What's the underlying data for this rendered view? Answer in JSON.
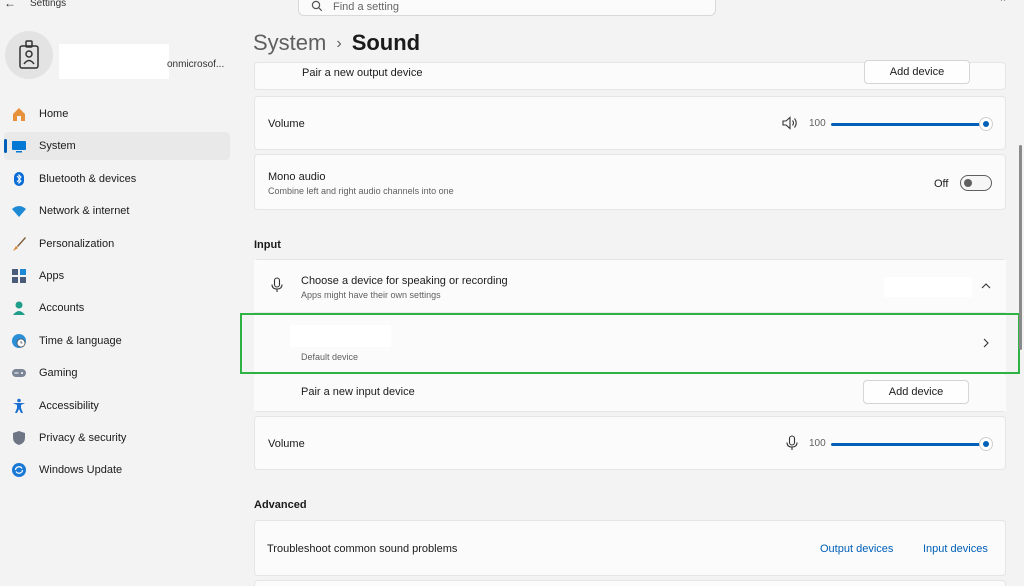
{
  "window": {
    "back_glyph": "←",
    "title": "Settings",
    "minimize_glyph": "–",
    "close_glyph": "×"
  },
  "search": {
    "placeholder": "Find a setting"
  },
  "user": {
    "email_suffix": "onmicrosof..."
  },
  "sidebar": {
    "items": [
      {
        "label": "Home",
        "icon": "home-icon",
        "color": "#e8913b"
      },
      {
        "label": "System",
        "icon": "system-icon",
        "color": "#0078d4",
        "active": true
      },
      {
        "label": "Bluetooth & devices",
        "icon": "bluetooth-icon",
        "color": "#0a6cd6"
      },
      {
        "label": "Network & internet",
        "icon": "wifi-icon",
        "color": "#1e8ad6"
      },
      {
        "label": "Personalization",
        "icon": "brush-icon",
        "color": "#d9822b"
      },
      {
        "label": "Apps",
        "icon": "apps-icon",
        "color": "#4a5c7a"
      },
      {
        "label": "Accounts",
        "icon": "person-icon",
        "color": "#1f9e8a"
      },
      {
        "label": "Time & language",
        "icon": "globe-clock-icon",
        "color": "#2a8fd6"
      },
      {
        "label": "Gaming",
        "icon": "gamepad-icon",
        "color": "#7a8596"
      },
      {
        "label": "Accessibility",
        "icon": "accessibility-icon",
        "color": "#1a6fd1"
      },
      {
        "label": "Privacy & security",
        "icon": "shield-icon",
        "color": "#6e7685"
      },
      {
        "label": "Windows Update",
        "icon": "update-icon",
        "color": "#1a79d4"
      }
    ]
  },
  "breadcrumb": {
    "parent": "System",
    "separator": "›",
    "current": "Sound"
  },
  "output": {
    "pair_label": "Pair a new output device",
    "add_device_label": "Add device",
    "volume_label": "Volume",
    "volume_value": "100",
    "volume_level_percent": 100,
    "mono_label": "Mono audio",
    "mono_desc": "Combine left and right audio channels into one",
    "mono_state": "Off"
  },
  "input": {
    "heading": "Input",
    "choose_label": "Choose a device for speaking or recording",
    "choose_desc": "Apps might have their own settings",
    "default_device_label": "Default device",
    "pair_label": "Pair a new input device",
    "add_device_label": "Add device",
    "volume_label": "Volume",
    "volume_value": "100",
    "volume_level_percent": 100
  },
  "advanced": {
    "heading": "Advanced",
    "troubleshoot_label": "Troubleshoot common sound problems",
    "output_devices_link": "Output devices",
    "input_devices_link": "Input devices"
  },
  "colors": {
    "accent": "#005fb8",
    "highlight": "#2db343"
  }
}
